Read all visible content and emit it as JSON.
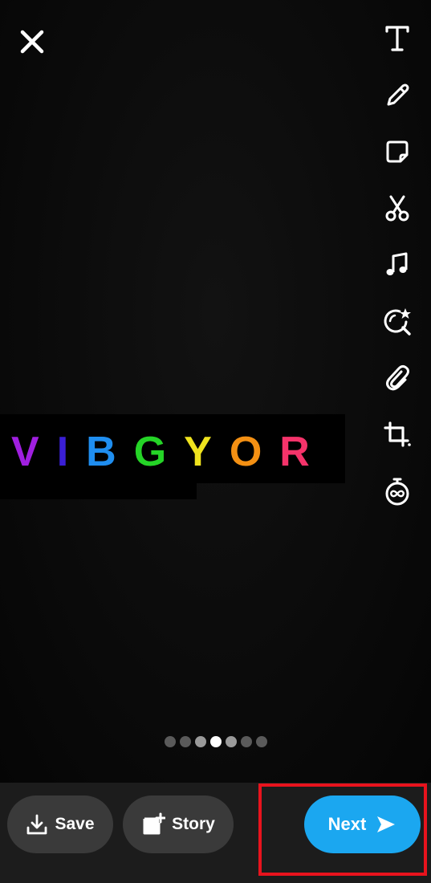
{
  "caption": {
    "letters": [
      {
        "char": "V",
        "color": "#a01fe0"
      },
      {
        "char": "I",
        "color": "#3a1fd6"
      },
      {
        "char": "B",
        "color": "#1f8ef0"
      },
      {
        "char": "G",
        "color": "#25d427"
      },
      {
        "char": "Y",
        "color": "#efe31e"
      },
      {
        "char": "O",
        "color": "#f49013"
      },
      {
        "char": "R",
        "color": "#f5336a"
      }
    ]
  },
  "toolbar": {
    "tools": [
      "text-icon",
      "pencil-icon",
      "sticker-icon",
      "scissors-icon",
      "music-icon",
      "lens-sparkle-icon",
      "paperclip-icon",
      "crop-icon",
      "timer-loop-icon"
    ]
  },
  "pager": {
    "count": 7,
    "active_index": 3
  },
  "bottom": {
    "save_label": "Save",
    "story_label": "Story",
    "next_label": "Next"
  },
  "colors": {
    "next_button": "#1ba7f0",
    "highlight_border": "#e8131d"
  }
}
